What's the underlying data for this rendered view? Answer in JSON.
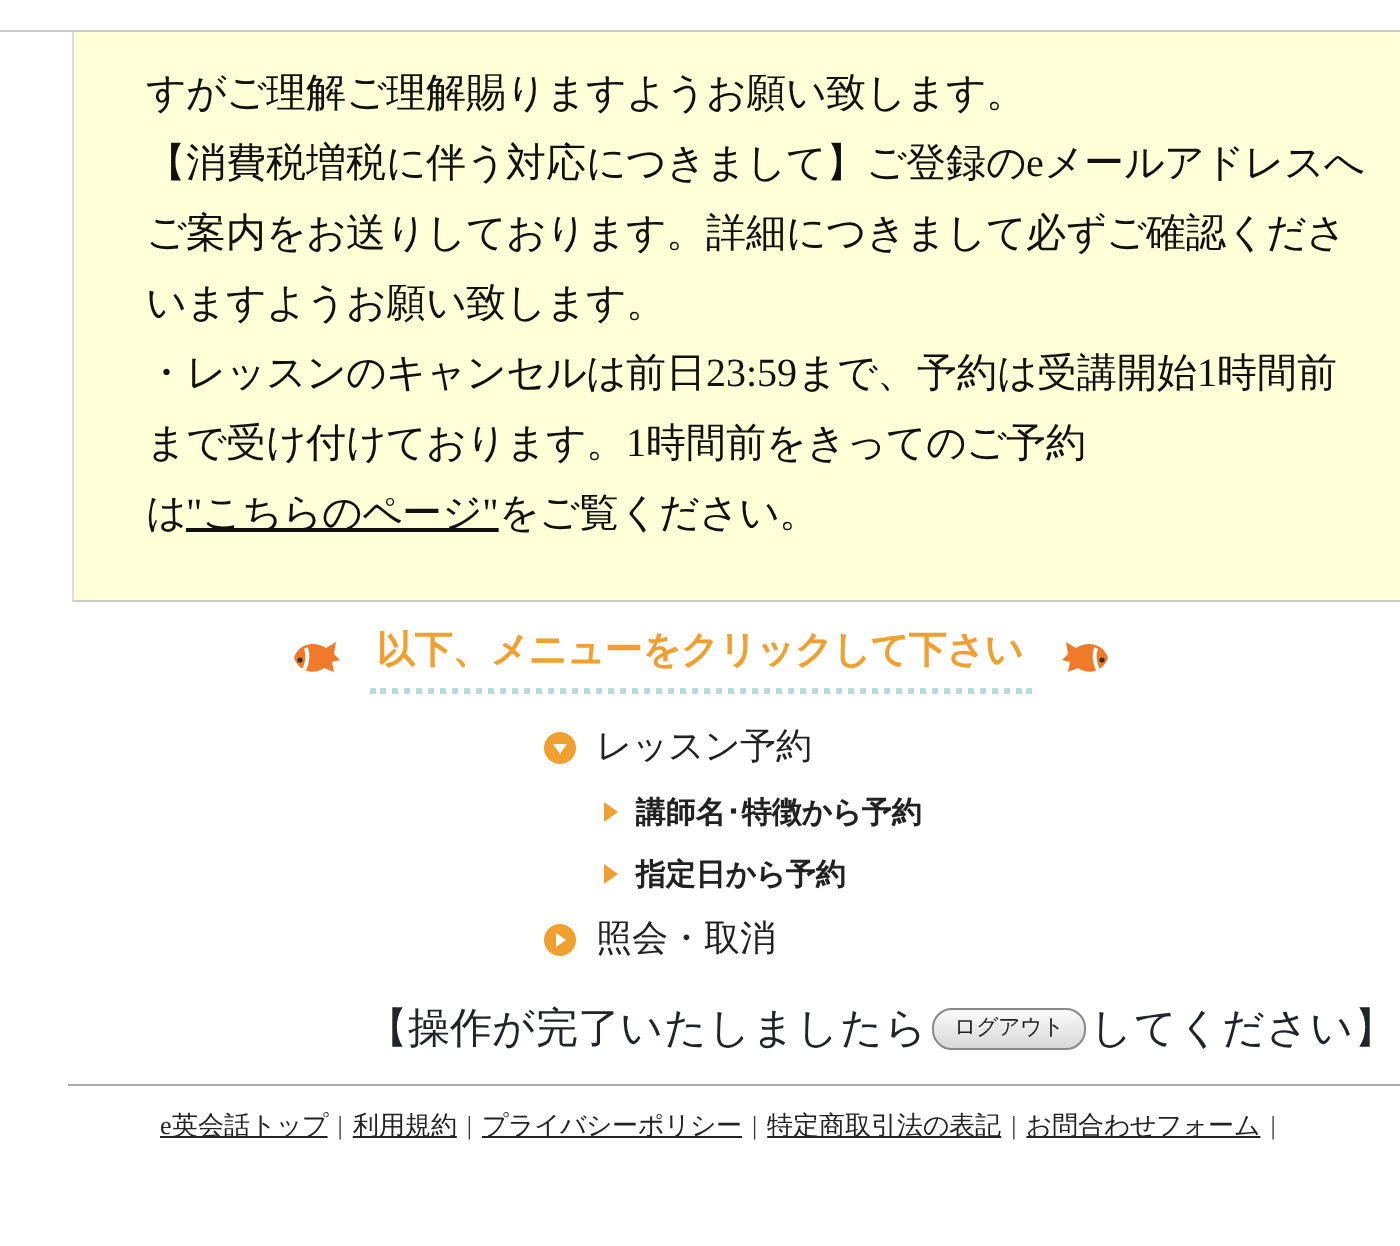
{
  "notice": {
    "paragraphs": [
      {
        "text": "すがご理解ご理解賜りますようお願い致します。"
      },
      {
        "text": "【消費税増税に伴う対応につきまして】ご登録のeメールアドレスへご案内をお送りしております。詳細につきまして必ずご確認くださいますようお願い致します。"
      },
      {
        "text": "・レッスンのキャンセルは前日23:59まで、予約は受講開始1時間前まで受け付けております。1時間前をきってのご予約は",
        "link": "\"こちらのページ\"",
        "after": "をご覧ください。"
      }
    ]
  },
  "menu": {
    "title": "以下、メニューをクリックして下さい",
    "items": [
      {
        "label": "レッスン予約",
        "expanded": true,
        "children": [
          {
            "label": "講師名･特徴から予約"
          },
          {
            "label": "指定日から予約"
          }
        ]
      },
      {
        "label": "照会・取消",
        "expanded": false
      }
    ]
  },
  "logout": {
    "before": "【操作が完了いたしましたら",
    "button": "ログアウト",
    "after": "してください】"
  },
  "footer": {
    "links": [
      "e英会話トップ",
      "利用規約",
      "プライバシーポリシー",
      "特定商取引法の表記",
      "お問合わせフォーム"
    ],
    "separator": "|"
  }
}
